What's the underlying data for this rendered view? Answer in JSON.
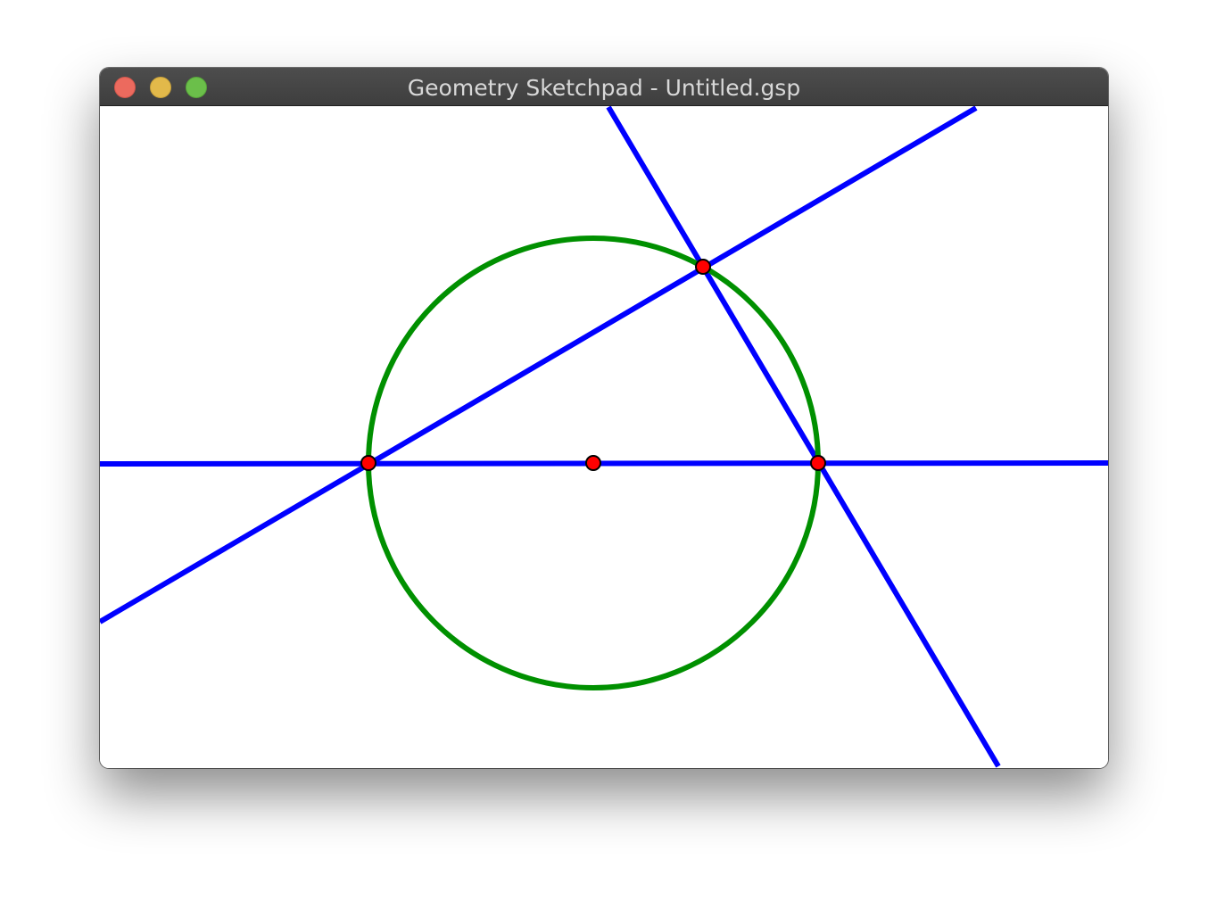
{
  "window": {
    "title": "Geometry Sketchpad - Untitled.gsp"
  },
  "colors": {
    "line": "#0000ff",
    "circle": "#009000",
    "point_fill": "#ff0000",
    "point_stroke": "#000000"
  },
  "sketch": {
    "lines": [
      {
        "name": "horizontal-line"
      },
      {
        "name": "tangent-line-left"
      },
      {
        "name": "tangent-line-right"
      }
    ],
    "circle": {
      "name": "circle"
    },
    "points": [
      {
        "name": "point-left"
      },
      {
        "name": "point-center"
      },
      {
        "name": "point-right"
      },
      {
        "name": "point-top"
      }
    ]
  }
}
